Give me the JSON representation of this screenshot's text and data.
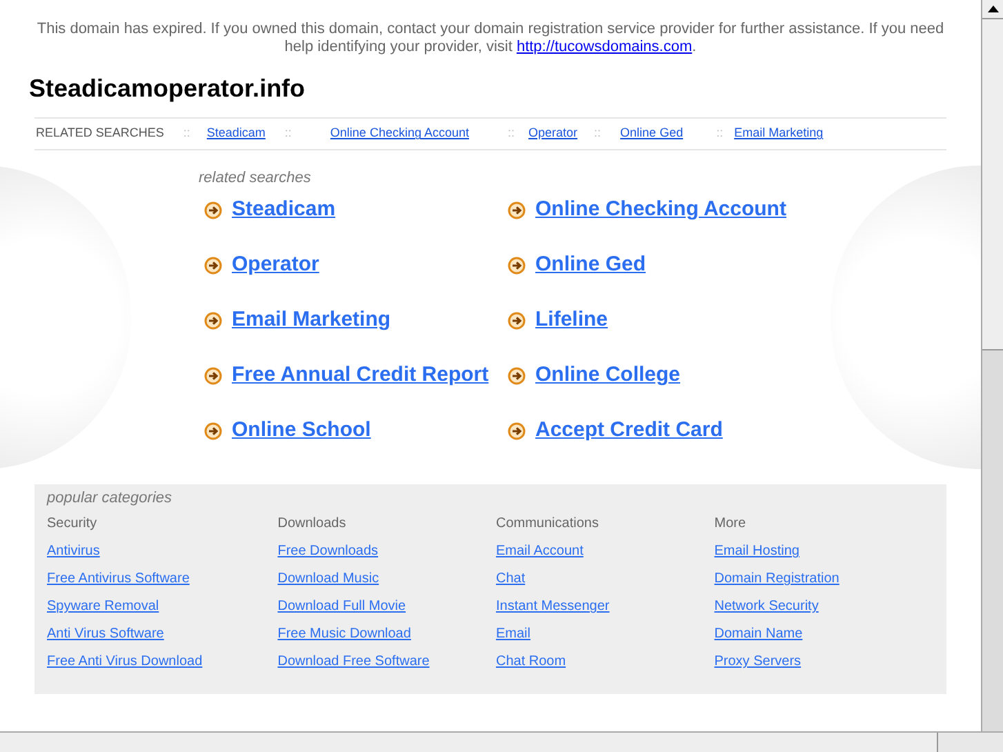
{
  "notice": {
    "text": "This domain has expired. If you owned this domain, contact your domain registration service provider for further assistance. If you need help identifying your provider, visit",
    "link": "http://tucowsdomains.com",
    "end": "."
  },
  "site_title": "Steadicamoperator.info",
  "related_bar": {
    "label": "RELATED SEARCHES",
    "separator": "::",
    "links": [
      "Steadicam",
      "Online Checking Account",
      "Operator",
      "Online Ged",
      "Email Marketing"
    ]
  },
  "related_searches": {
    "heading": "related searches",
    "links": [
      {
        "text": "Steadicam"
      },
      {
        "text": "Online Checking Account"
      },
      {
        "text": "Operator"
      },
      {
        "text": "Online Ged"
      },
      {
        "text": "Email Marketing"
      },
      {
        "text": "Lifeline"
      },
      {
        "text": "Free Annual Credit Report"
      },
      {
        "text": "Online College"
      },
      {
        "text": "Online School"
      },
      {
        "text": "Accept Credit Card"
      }
    ]
  },
  "popular_categories": {
    "heading": "popular categories",
    "columns": [
      {
        "title": "Security",
        "links": [
          "Antivirus",
          "Free Antivirus Software",
          "Spyware Removal",
          "Anti Virus Software",
          "Free Anti Virus Download"
        ]
      },
      {
        "title": "Downloads",
        "links": [
          "Free Downloads",
          "Download Music",
          "Download Full Movie",
          "Free Music Download",
          "Download Free Software"
        ]
      },
      {
        "title": "Communications",
        "links": [
          "Email Account",
          "Chat",
          "Instant Messenger",
          "Email",
          "Chat Room"
        ]
      },
      {
        "title": "More",
        "links": [
          "Email Hosting",
          "Domain Registration",
          "Network Security",
          "Domain Name",
          "Proxy Servers"
        ]
      }
    ]
  }
}
